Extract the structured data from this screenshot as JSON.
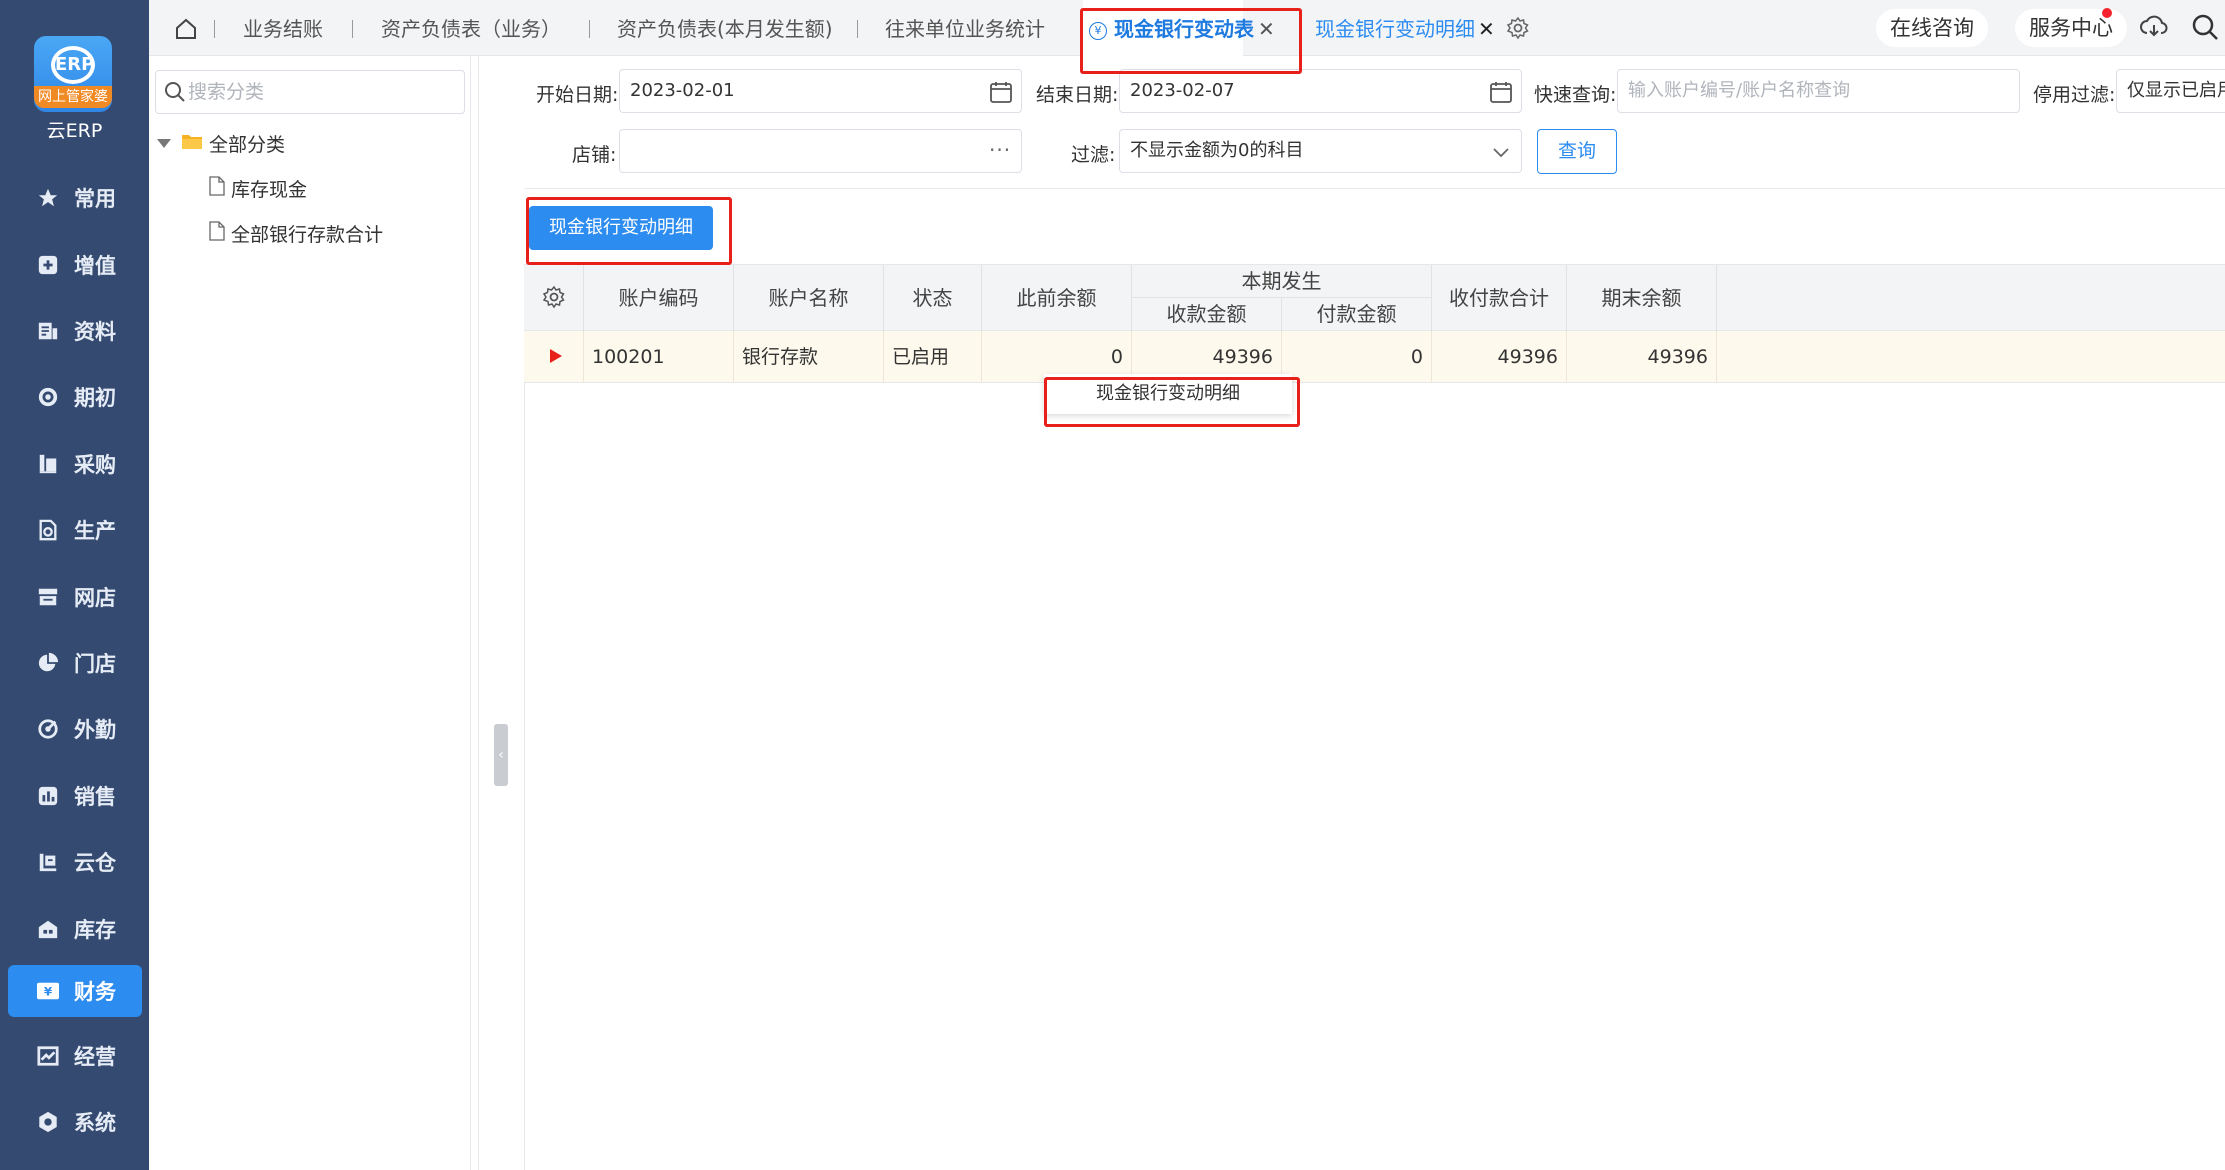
{
  "nav": {
    "logo_mark": "ERP",
    "logo_ribbon": "网上管家婆",
    "logo_name": "云ERP",
    "items": [
      {
        "label": "常用",
        "icon": "star-icon"
      },
      {
        "label": "增值",
        "icon": "plus-square-icon"
      },
      {
        "label": "资料",
        "icon": "document-list-icon"
      },
      {
        "label": "期初",
        "icon": "target-icon"
      },
      {
        "label": "采购",
        "icon": "shopping-book-icon"
      },
      {
        "label": "生产",
        "icon": "production-doc-icon"
      },
      {
        "label": "网店",
        "icon": "store-icon"
      },
      {
        "label": "门店",
        "icon": "pie-chart-icon"
      },
      {
        "label": "外勤",
        "icon": "field-work-icon"
      },
      {
        "label": "销售",
        "icon": "bar-chart-icon"
      },
      {
        "label": "云仓",
        "icon": "cloud-warehouse-icon"
      },
      {
        "label": "库存",
        "icon": "warehouse-icon"
      },
      {
        "label": "财务",
        "icon": "finance-icon"
      },
      {
        "label": "经营",
        "icon": "operations-icon"
      },
      {
        "label": "系统",
        "icon": "system-gear-icon"
      }
    ],
    "active_index": 12
  },
  "tabs": [
    {
      "label": "业务结账"
    },
    {
      "label": "资产负债表（业务）"
    },
    {
      "label": "资产负债表(本月发生额)"
    },
    {
      "label": "往来单位业务统计"
    },
    {
      "label": "现金银行变动表",
      "close": "✕",
      "active": true
    },
    {
      "label": "现金银行变动明细",
      "close": "✕"
    }
  ],
  "top_buttons": {
    "consult": "在线咨询",
    "service": "服务中心"
  },
  "category": {
    "search_placeholder": "搜索分类",
    "root": "全部分类",
    "children": [
      "库存现金",
      "全部银行存款合计"
    ]
  },
  "filters": {
    "start_label": "开始日期:",
    "start_value": "2023-02-01",
    "end_label": "结束日期:",
    "end_value": "2023-02-07",
    "quick_label": "快速查询:",
    "quick_placeholder": "输入账户编号/账户名称查询",
    "disabled_label": "停用过滤:",
    "disabled_value": "仅显示已启用",
    "store_label": "店铺:",
    "store_value": "",
    "filter_label": "过滤:",
    "filter_value": "不显示金额为0的科目",
    "query_button": "查询"
  },
  "detail_button": "现金银行变动明细",
  "table": {
    "headers": {
      "code": "账户编码",
      "name": "账户名称",
      "status": "状态",
      "prior": "此前余额",
      "period": "本期发生",
      "receipt": "收款金额",
      "payment": "付款金额",
      "total": "收付款合计",
      "ending": "期末余额"
    },
    "rows": [
      {
        "code": "100201",
        "name": "银行存款",
        "status": "已启用",
        "prior": "0",
        "receipt": "49396",
        "payment": "0",
        "total": "49396",
        "ending": "49396"
      }
    ]
  },
  "tooltip": "现金银行变动明细",
  "colors": {
    "nav_bg": "#344a70",
    "accent": "#2d8cf0",
    "highlight": "#e8201a",
    "row_bg": "#fdf9ec"
  }
}
